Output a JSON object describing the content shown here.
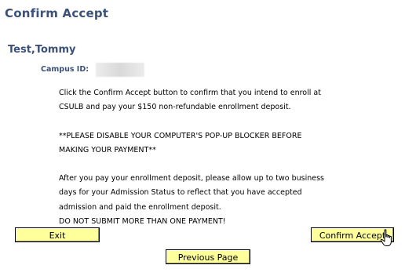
{
  "page": {
    "title": "Confirm Accept"
  },
  "student": {
    "name": "Test,Tommy",
    "campus_id_label": "Campus ID:",
    "campus_id_value": ""
  },
  "message": {
    "paragraph_1": "Click the Confirm Accept button to confirm that you intend to enroll at\nCSULB and pay your $150 non-refundable enrollment deposit.",
    "paragraph_2": "**PLEASE DISABLE YOUR COMPUTER'S POP-UP BLOCKER BEFORE\nMAKING YOUR PAYMENT**",
    "paragraph_3": "After you pay your enrollment deposit, please allow up to two business\ndays for your Admission Status to reflect that you have accepted\nadmission and paid the enrollment deposit.\nDO NOT SUBMIT MORE THAN ONE PAYMENT!"
  },
  "buttons": {
    "exit_label": "Exit",
    "confirm_label": "Confirm Accept",
    "previous_label": "Previous Page"
  },
  "colors": {
    "heading": "#3b5178",
    "button_bg": "#ffff9c",
    "button_border": "#000000"
  },
  "icons": {
    "cursor": "hand-pointer-icon"
  }
}
